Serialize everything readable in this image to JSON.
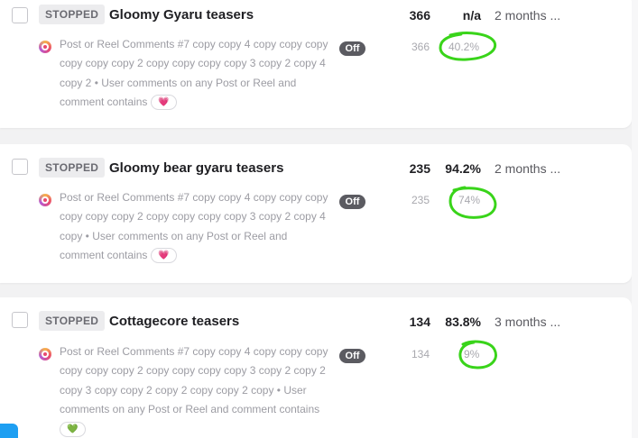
{
  "rows": [
    {
      "status": "STOPPED",
      "title": "Gloomy Gyaru teasers",
      "count": "366",
      "percent": "n/a",
      "time": "2 months ...",
      "description": "Post or Reel Comments #7 copy copy 4 copy copy copy copy copy copy 2 copy copy copy copy 3 copy 2 copy 4 copy 2 • User comments on any Post or Reel and comment contains",
      "emoji": "💗",
      "toggle": "Off",
      "sub_count": "366",
      "sub_percent": "40.2%"
    },
    {
      "status": "STOPPED",
      "title": "Gloomy bear gyaru teasers",
      "count": "235",
      "percent": "94.2%",
      "time": "2 months ...",
      "description": "Post or Reel Comments #7 copy copy 4 copy copy copy copy copy copy 2 copy copy copy copy 3 copy 2 copy 4 copy • User comments on any Post or Reel and comment contains",
      "emoji": "💗",
      "toggle": "Off",
      "sub_count": "235",
      "sub_percent": "74%"
    },
    {
      "status": "STOPPED",
      "title": "Cottagecore teasers",
      "count": "134",
      "percent": "83.8%",
      "time": "3 months ...",
      "description": "Post or Reel Comments #7 copy copy 4 copy copy copy copy copy copy 2 copy copy copy copy 3 copy 2 copy 2 copy 3 copy copy 2 copy 2 copy copy 2 copy • User comments on any Post or Reel and comment contains",
      "emoji": "💚",
      "toggle": "Off",
      "sub_count": "134",
      "sub_percent": "9%"
    }
  ],
  "colors": {
    "annotation_circle": "#39d41a",
    "toggle_off": "#5b5b61",
    "status_badge_bg": "#ececee"
  },
  "icons": {
    "row_icon": "instagram-icon",
    "annotation": "green-hand-drawn-circle"
  }
}
